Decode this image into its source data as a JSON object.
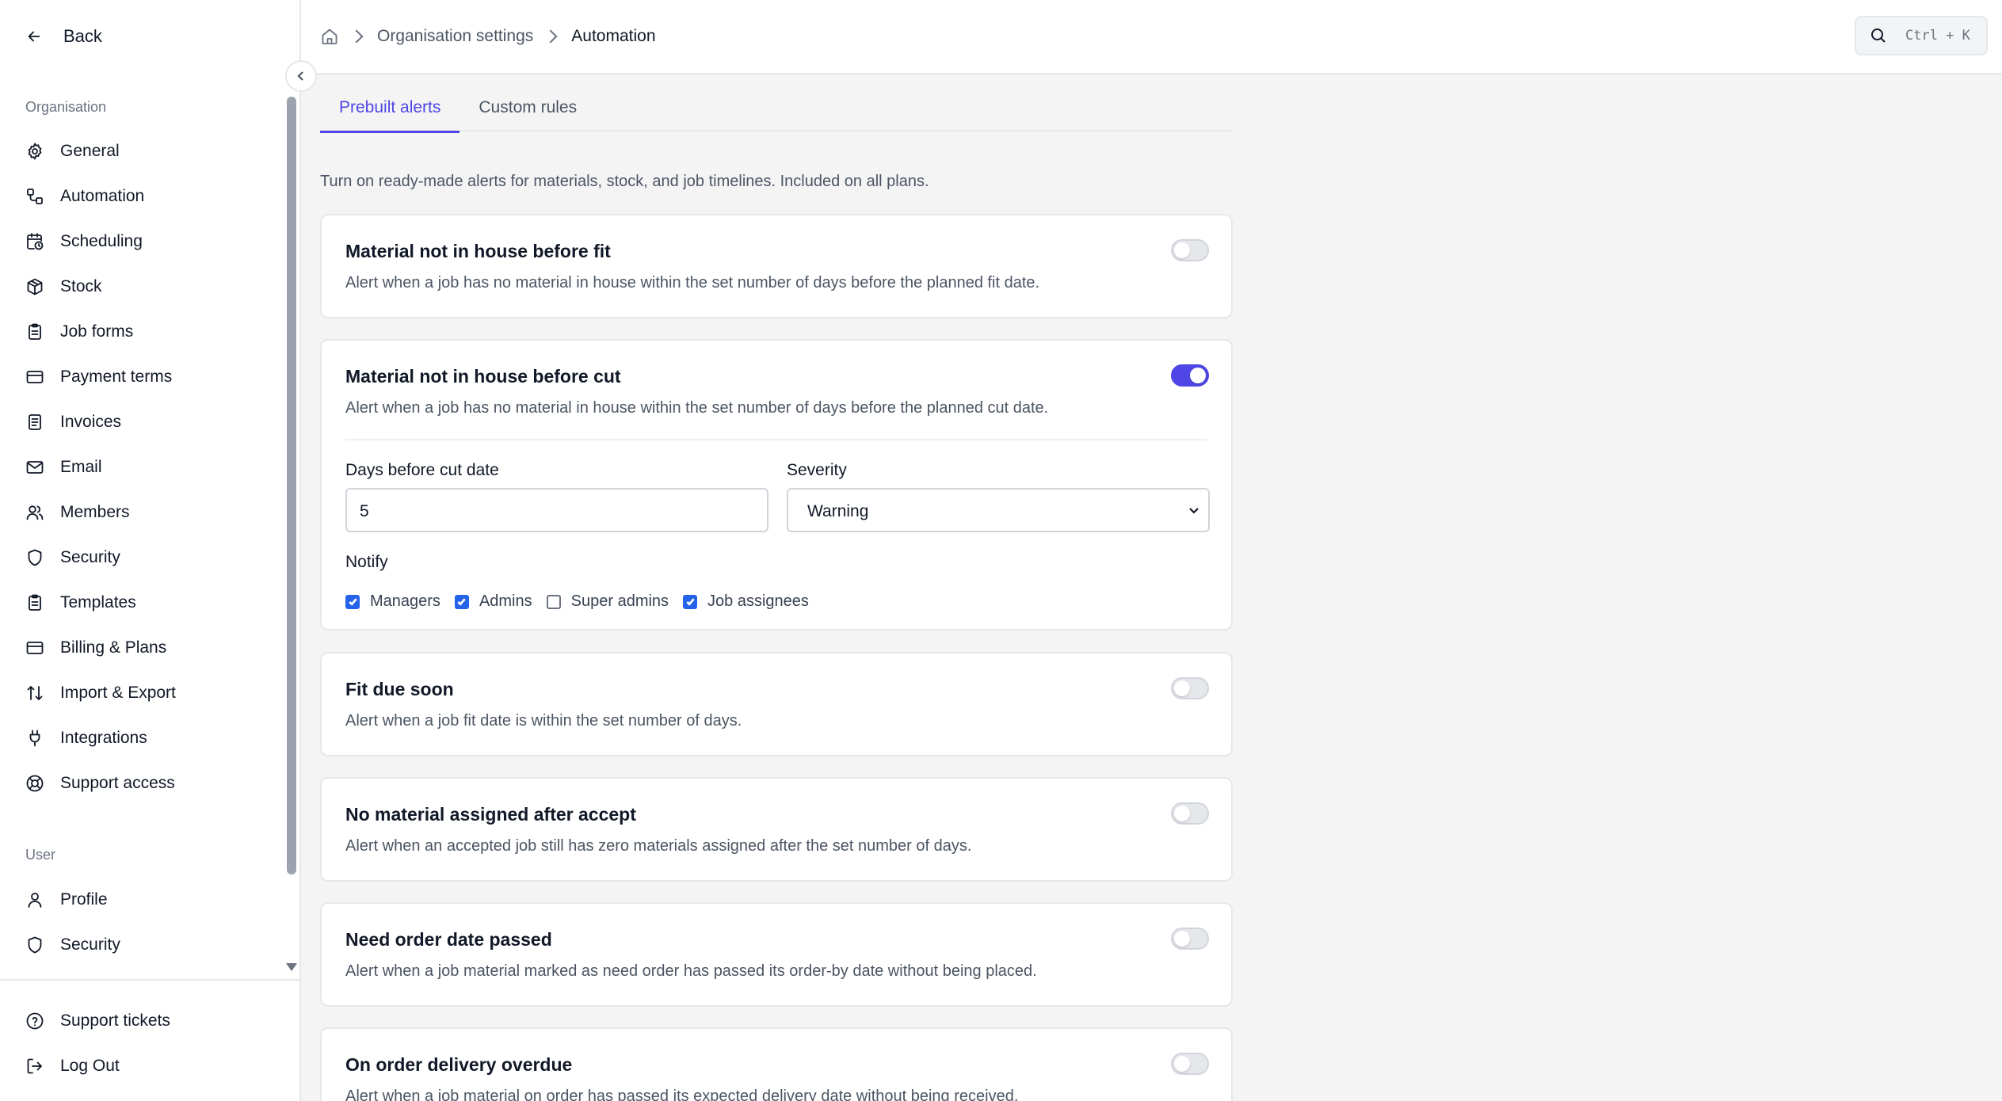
{
  "sidebar": {
    "back_label": "Back",
    "organisation_label": "Organisation",
    "organisation_items": [
      {
        "label": "General",
        "icon": "gear-icon"
      },
      {
        "label": "Automation",
        "icon": "workflow-icon"
      },
      {
        "label": "Scheduling",
        "icon": "calendar-clock-icon"
      },
      {
        "label": "Stock",
        "icon": "package-icon"
      },
      {
        "label": "Job forms",
        "icon": "clipboard-icon"
      },
      {
        "label": "Payment terms",
        "icon": "credit-card-icon"
      },
      {
        "label": "Invoices",
        "icon": "receipt-icon"
      },
      {
        "label": "Email",
        "icon": "mail-icon"
      },
      {
        "label": "Members",
        "icon": "users-icon"
      },
      {
        "label": "Security",
        "icon": "shield-icon"
      },
      {
        "label": "Templates",
        "icon": "clipboard-icon"
      },
      {
        "label": "Billing & Plans",
        "icon": "credit-card-icon"
      },
      {
        "label": "Import & Export",
        "icon": "arrows-up-down-icon"
      },
      {
        "label": "Integrations",
        "icon": "plug-icon"
      },
      {
        "label": "Support access",
        "icon": "lifebuoy-icon"
      }
    ],
    "user_label": "User",
    "user_items": [
      {
        "label": "Profile",
        "icon": "user-icon"
      },
      {
        "label": "Security",
        "icon": "shield-icon"
      }
    ],
    "footer_items": [
      {
        "label": "Support tickets",
        "icon": "help-circle-icon"
      },
      {
        "label": "Log Out",
        "icon": "log-out-icon"
      }
    ]
  },
  "header": {
    "breadcrumb": [
      "Organisation settings",
      "Automation"
    ],
    "search_shortcut": "Ctrl + K"
  },
  "tabs": [
    {
      "label": "Prebuilt alerts",
      "active": true
    },
    {
      "label": "Custom rules",
      "active": false
    }
  ],
  "intro": "Turn on ready-made alerts for materials, stock, and job timelines. Included on all plans.",
  "alerts": [
    {
      "title": "Material not in house before fit",
      "description": "Alert when a job has no material in house within the set number of days before the planned fit date.",
      "enabled": false
    },
    {
      "title": "Material not in house before cut",
      "description": "Alert when a job has no material in house within the set number of days before the planned cut date.",
      "enabled": true,
      "days_label": "Days before cut date",
      "days_value": "5",
      "severity_label": "Severity",
      "severity_value": "Warning",
      "notify_label": "Notify",
      "notify_options": [
        {
          "label": "Managers",
          "checked": true
        },
        {
          "label": "Admins",
          "checked": true
        },
        {
          "label": "Super admins",
          "checked": false
        },
        {
          "label": "Job assignees",
          "checked": true
        }
      ]
    },
    {
      "title": "Fit due soon",
      "description": "Alert when a job fit date is within the set number of days.",
      "enabled": false
    },
    {
      "title": "No material assigned after accept",
      "description": "Alert when an accepted job still has zero materials assigned after the set number of days.",
      "enabled": false
    },
    {
      "title": "Need order date passed",
      "description": "Alert when a job material marked as need order has passed its order-by date without being placed.",
      "enabled": false
    },
    {
      "title": "On order delivery overdue",
      "description": "Alert when a job material on order has passed its expected delivery date without being received.",
      "enabled": false
    }
  ],
  "colors": {
    "accent": "#4f46e5",
    "checkbox": "#2563eb"
  }
}
